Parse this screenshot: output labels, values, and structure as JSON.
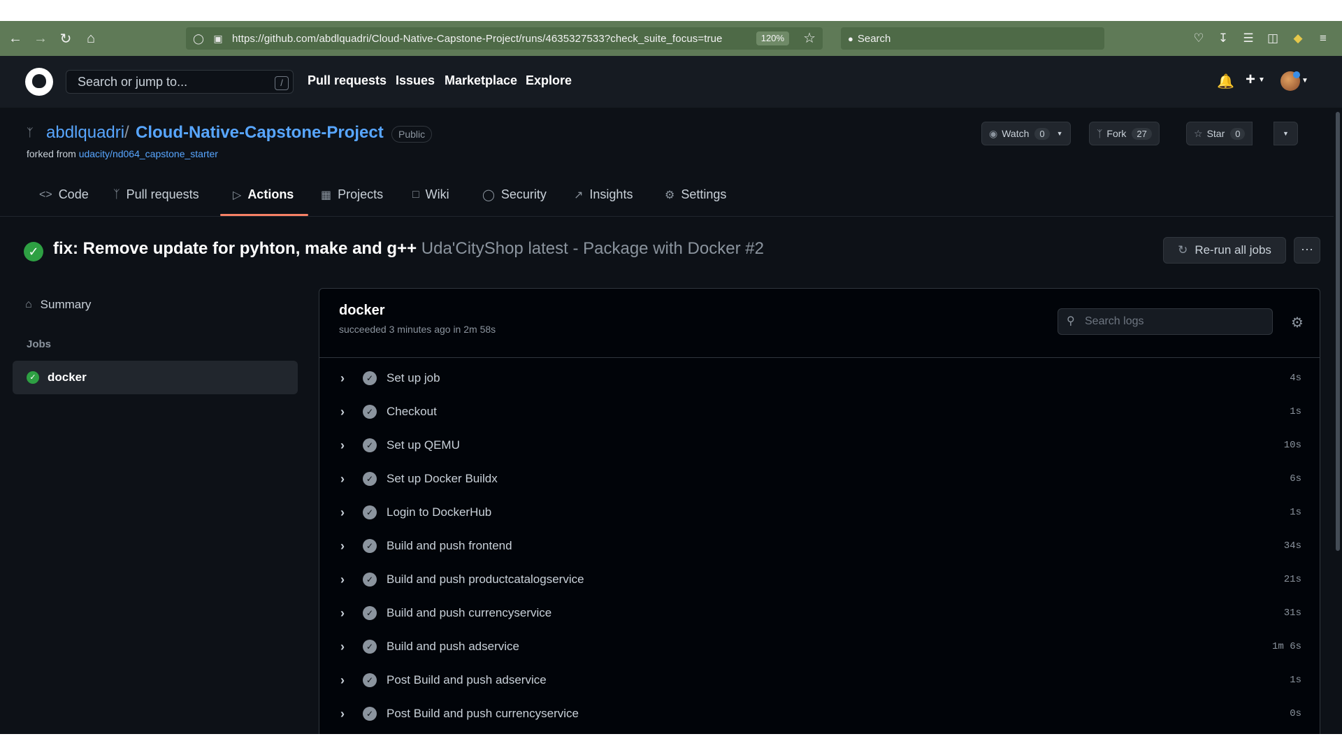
{
  "browser": {
    "url": "https://github.com/abdlquadri/Cloud-Native-Capstone-Project/runs/4635327533?check_suite_focus=true",
    "zoom": "120%",
    "search_placeholder": "Search"
  },
  "header": {
    "search_placeholder": "Search or jump to...",
    "slash_key": "/",
    "nav": [
      "Pull requests",
      "Issues",
      "Marketplace",
      "Explore"
    ]
  },
  "repo": {
    "owner": "abdlquadri",
    "separator": "/",
    "name": "Cloud-Native-Capstone-Project",
    "visibility": "Public",
    "forked_from_label": "forked from",
    "forked_from_repo": "udacity/nd064_capstone_starter",
    "watch_label": "Watch",
    "watch_count": "0",
    "fork_label": "Fork",
    "fork_count": "27",
    "star_label": "Star",
    "star_count": "0"
  },
  "tabs": [
    {
      "label": "Code",
      "icon": "code-icon"
    },
    {
      "label": "Pull requests",
      "icon": "pull-request-icon"
    },
    {
      "label": "Actions",
      "icon": "play-icon",
      "active": true
    },
    {
      "label": "Projects",
      "icon": "table-icon"
    },
    {
      "label": "Wiki",
      "icon": "book-icon"
    },
    {
      "label": "Security",
      "icon": "shield-icon"
    },
    {
      "label": "Insights",
      "icon": "graph-icon"
    },
    {
      "label": "Settings",
      "icon": "gear-icon"
    }
  ],
  "run": {
    "title": "fix: Remove update for pyhton, make and g++",
    "subtitle": "Uda'CityShop latest - Package with Docker #2",
    "rerun_label": "Re-run all jobs",
    "more_label": "···"
  },
  "sidebar": {
    "summary_label": "Summary",
    "jobs_heading": "Jobs",
    "job_label": "docker"
  },
  "job": {
    "name": "docker",
    "status": "succeeded 3 minutes ago in 2m 58s",
    "search_placeholder": "Search logs",
    "steps": [
      {
        "name": "Set up job",
        "duration": "4s"
      },
      {
        "name": "Checkout",
        "duration": "1s"
      },
      {
        "name": "Set up QEMU",
        "duration": "10s"
      },
      {
        "name": "Set up Docker Buildx",
        "duration": "6s"
      },
      {
        "name": "Login to DockerHub",
        "duration": "1s"
      },
      {
        "name": "Build and push frontend",
        "duration": "34s"
      },
      {
        "name": "Build and push productcatalogservice",
        "duration": "21s"
      },
      {
        "name": "Build and push currencyservice",
        "duration": "31s"
      },
      {
        "name": "Build and push adservice",
        "duration": "1m 6s"
      },
      {
        "name": "Post Build and push adservice",
        "duration": "1s"
      },
      {
        "name": "Post Build and push currencyservice",
        "duration": "0s"
      }
    ]
  },
  "colors": {
    "browser_chrome": "#5f7a57",
    "gh_header": "#161b22",
    "gh_body": "#0d1117",
    "link": "#58a6ff",
    "success": "#2ea043",
    "tab_underline": "#f78166"
  }
}
